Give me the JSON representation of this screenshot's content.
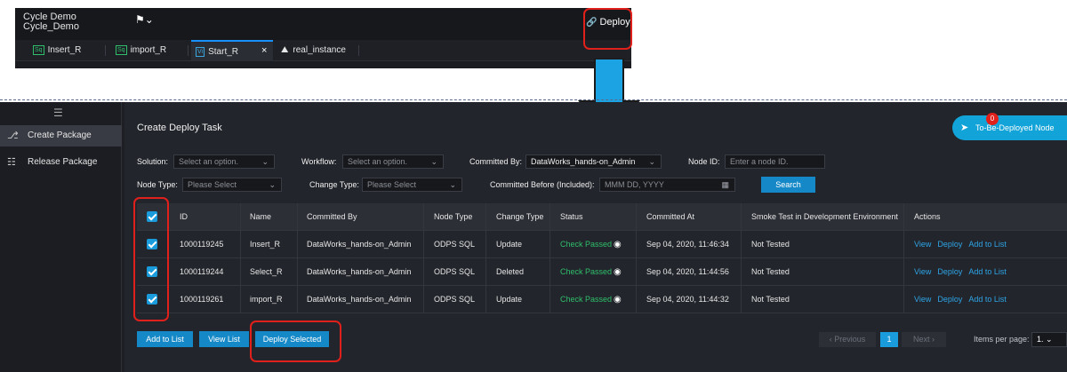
{
  "top": {
    "workflow_name_line1": "Cycle Demo",
    "workflow_name_line2": "Cycle_Demo",
    "bookmark_icon": "bookmark-icon",
    "deploy_label": "Deploy",
    "tabs": [
      {
        "badge": "Sq",
        "label": "Insert_R"
      },
      {
        "badge": "Sq",
        "label": "import_R"
      },
      {
        "badge": "Vi",
        "label": "Start_R"
      },
      {
        "badge": "",
        "label": "real_instance"
      }
    ],
    "close_glyph": "×"
  },
  "sidebar": {
    "items": [
      {
        "label": "Create Package",
        "icon": "package-add-icon"
      },
      {
        "label": "Release Package",
        "icon": "list-icon"
      }
    ]
  },
  "header": {
    "title": "Create Deploy Task",
    "to_be_deployed_label": "To-Be-Deployed Node",
    "to_be_deployed_count": "0"
  },
  "filters": {
    "solution_label": "Solution:",
    "solution_placeholder": "Select an option.",
    "workflow_label": "Workflow:",
    "workflow_placeholder": "Select an option.",
    "committed_by_label": "Committed By:",
    "committed_by_value": "DataWorks_hands-on_Admin",
    "node_id_label": "Node ID:",
    "node_id_placeholder": "Enter a node ID.",
    "node_type_label": "Node Type:",
    "node_type_placeholder": "Please Select",
    "change_type_label": "Change Type:",
    "change_type_placeholder": "Please Select",
    "committed_before_label": "Committed Before (Included):",
    "committed_before_placeholder": "MMM DD, YYYY",
    "search_label": "Search"
  },
  "table": {
    "headers": [
      "ID",
      "Name",
      "Committed By",
      "Node Type",
      "Change Type",
      "Status",
      "Committed At",
      "Smoke Test in Development Environment",
      "Actions"
    ],
    "rows": [
      {
        "id": "1000119245",
        "name": "Insert_R",
        "committed_by": "DataWorks_hands-on_Admin",
        "node_type": "ODPS SQL",
        "change_type": "Update",
        "status": "Check Passed",
        "committed_at": "Sep 04, 2020, 11:46:34",
        "smoke_test": "Not Tested"
      },
      {
        "id": "1000119244",
        "name": "Select_R",
        "committed_by": "DataWorks_hands-on_Admin",
        "node_type": "ODPS SQL",
        "change_type": "Deleted",
        "status": "Check Passed",
        "committed_at": "Sep 04, 2020, 11:44:56",
        "smoke_test": "Not Tested"
      },
      {
        "id": "1000119261",
        "name": "import_R",
        "committed_by": "DataWorks_hands-on_Admin",
        "node_type": "ODPS SQL",
        "change_type": "Update",
        "status": "Check Passed",
        "committed_at": "Sep 04, 2020, 11:44:32",
        "smoke_test": "Not Tested"
      }
    ],
    "actions": {
      "view": "View",
      "deploy": "Deploy",
      "add": "Add to List"
    }
  },
  "footer": {
    "add_to_list": "Add to List",
    "view_list": "View List",
    "deploy_selected": "Deploy Selected",
    "previous": "Previous",
    "page": "1",
    "next": "Next",
    "items_per_page_label": "Items per page:",
    "items_per_page_value": "1."
  },
  "colors": {
    "accent": "#1588c7",
    "success": "#2fbf6b",
    "highlight": "#e0201b",
    "arrow": "#1ba3e3"
  }
}
